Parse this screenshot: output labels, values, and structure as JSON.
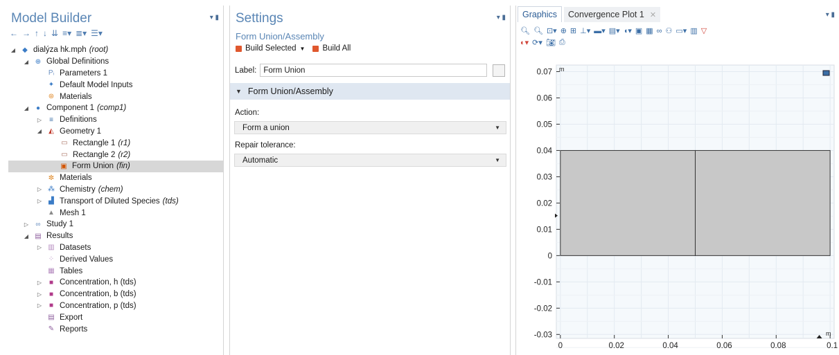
{
  "model_builder": {
    "title": "Model Builder",
    "toolbar": [
      "←",
      "→",
      "↑",
      "↓",
      "⇊",
      "≡▾",
      "≣▾",
      "☰▾"
    ],
    "tree": [
      {
        "level": 0,
        "twist": "◢",
        "icon": "app-file-icon",
        "label": "dialýza hk.mph",
        "tag": "(root)"
      },
      {
        "level": 1,
        "twist": "◢",
        "icon": "globe-icon",
        "label": "Global Definitions",
        "tag": ""
      },
      {
        "level": 2,
        "twist": "",
        "icon": "parameters-icon",
        "label": "Parameters 1",
        "tag": ""
      },
      {
        "level": 2,
        "twist": "",
        "icon": "model-inputs-icon",
        "label": "Default Model Inputs",
        "tag": ""
      },
      {
        "level": 2,
        "twist": "",
        "icon": "materials-icon",
        "label": "Materials",
        "tag": ""
      },
      {
        "level": 1,
        "twist": "◢",
        "icon": "component-icon",
        "label": "Component 1",
        "tag": "(comp1)"
      },
      {
        "level": 2,
        "twist": "▷",
        "icon": "definitions-icon",
        "label": "Definitions",
        "tag": ""
      },
      {
        "level": 2,
        "twist": "◢",
        "icon": "geometry-icon",
        "label": "Geometry 1",
        "tag": ""
      },
      {
        "level": 3,
        "twist": "",
        "icon": "rectangle-icon",
        "label": "Rectangle 1",
        "tag": "(r1)"
      },
      {
        "level": 3,
        "twist": "",
        "icon": "rectangle-icon",
        "label": "Rectangle 2",
        "tag": "(r2)"
      },
      {
        "level": 3,
        "twist": "",
        "icon": "form-union-icon",
        "label": "Form Union",
        "tag": "(fin)",
        "selected": true
      },
      {
        "level": 2,
        "twist": "",
        "icon": "materials-small-icon",
        "label": "Materials",
        "tag": ""
      },
      {
        "level": 2,
        "twist": "▷",
        "icon": "chemistry-icon",
        "label": "Chemistry",
        "tag": "(chem)"
      },
      {
        "level": 2,
        "twist": "▷",
        "icon": "transport-icon",
        "label": "Transport of Diluted Species",
        "tag": "(tds)"
      },
      {
        "level": 2,
        "twist": "",
        "icon": "mesh-icon",
        "label": "Mesh 1",
        "tag": ""
      },
      {
        "level": 1,
        "twist": "▷",
        "icon": "study-icon",
        "label": "Study 1",
        "tag": ""
      },
      {
        "level": 1,
        "twist": "◢",
        "icon": "results-icon",
        "label": "Results",
        "tag": ""
      },
      {
        "level": 2,
        "twist": "▷",
        "icon": "datasets-icon",
        "label": "Datasets",
        "tag": ""
      },
      {
        "level": 2,
        "twist": "",
        "icon": "derived-values-icon",
        "label": "Derived Values",
        "tag": ""
      },
      {
        "level": 2,
        "twist": "",
        "icon": "tables-icon",
        "label": "Tables",
        "tag": ""
      },
      {
        "level": 2,
        "twist": "▷",
        "icon": "plot-group-icon",
        "label": "Concentration, h (tds)",
        "tag": ""
      },
      {
        "level": 2,
        "twist": "▷",
        "icon": "plot-group-icon",
        "label": "Concentration, b (tds)",
        "tag": ""
      },
      {
        "level": 2,
        "twist": "▷",
        "icon": "plot-group-icon",
        "label": "Concentration, p (tds)",
        "tag": ""
      },
      {
        "level": 2,
        "twist": "",
        "icon": "export-icon",
        "label": "Export",
        "tag": ""
      },
      {
        "level": 2,
        "twist": "",
        "icon": "reports-icon",
        "label": "Reports",
        "tag": ""
      }
    ]
  },
  "settings": {
    "title": "Settings",
    "subtitle": "Form Union/Assembly",
    "build_selected": "Build Selected",
    "build_all": "Build All",
    "label_caption": "Label:",
    "label_value": "Form Union",
    "section_title": "Form Union/Assembly",
    "action_caption": "Action:",
    "action_value": "Form a union",
    "repair_caption": "Repair tolerance:",
    "repair_value": "Automatic"
  },
  "graphics": {
    "tab_graphics": "Graphics",
    "tab_convergence": "Convergence Plot 1",
    "tab_close": "✕",
    "unit_y": "m",
    "unit_x": "m",
    "colors": {
      "accent": "#5a86b5",
      "geometry_fill": "#c8c8c8",
      "plot_bg": "#f5f9fc"
    }
  },
  "chart_data": {
    "type": "scatter",
    "x_ticks": [
      "0",
      "0.02",
      "0.04",
      "0.06",
      "0.08",
      "0.1"
    ],
    "y_ticks": [
      "0.07",
      "0.06",
      "0.05",
      "0.04",
      "0.03",
      "0.02",
      "0.01",
      "0",
      "-0.01",
      "-0.02",
      "-0.03"
    ],
    "x_tick_values": [
      0,
      0.02,
      0.04,
      0.06,
      0.08,
      0.1
    ],
    "y_tick_values": [
      0.07,
      0.06,
      0.05,
      0.04,
      0.03,
      0.02,
      0.01,
      0,
      -0.01,
      -0.02,
      -0.03
    ],
    "xlim": [
      -0.0015,
      0.1015
    ],
    "ylim": [
      -0.0315,
      0.0725
    ],
    "rectangles": [
      {
        "name": "r1",
        "x0": 0,
        "y0": 0,
        "x1": 0.05,
        "y1": 0.04
      },
      {
        "name": "r2",
        "x0": 0.05,
        "y0": 0,
        "x1": 0.1,
        "y1": 0.04
      }
    ],
    "grid": true
  }
}
